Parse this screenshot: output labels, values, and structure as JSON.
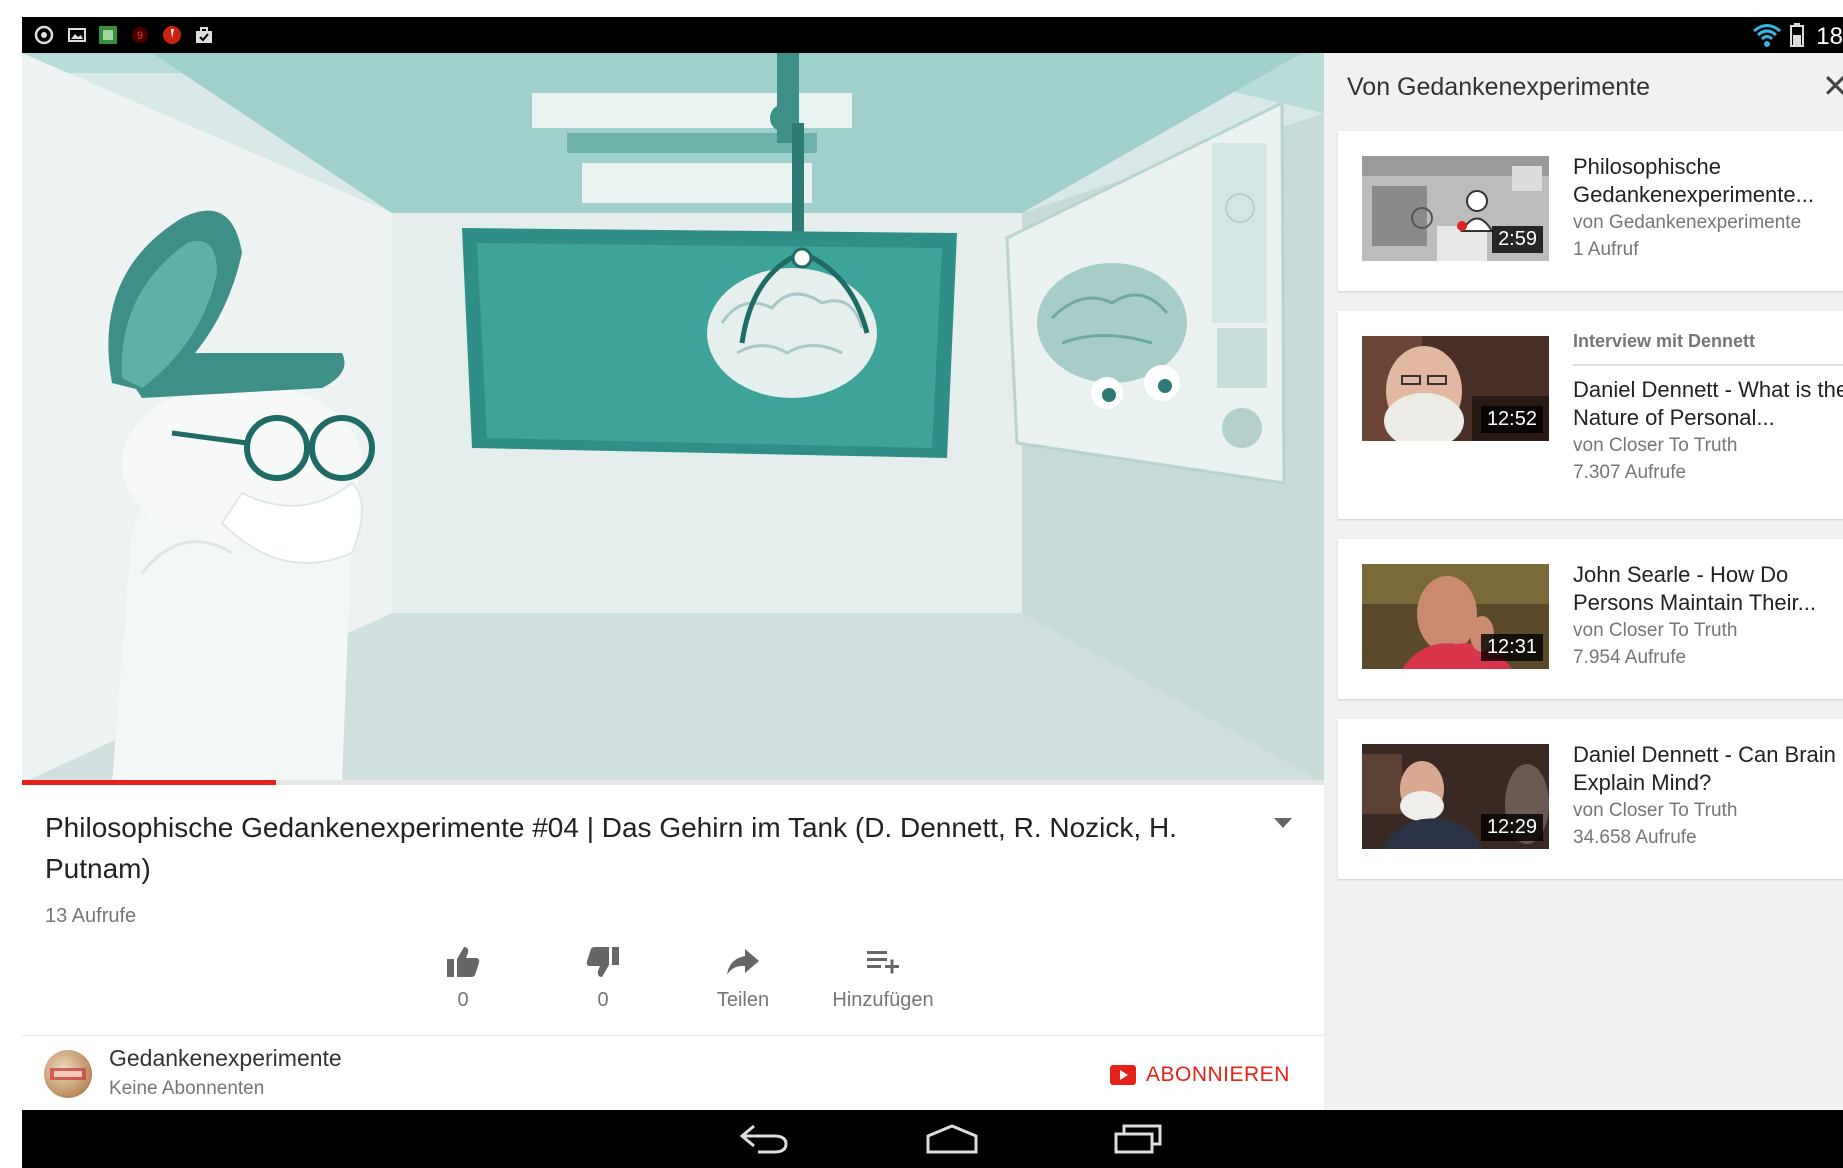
{
  "status_bar": {
    "time": "18",
    "left_icons": [
      "circle-icon",
      "image-icon",
      "app-icon",
      "notification-icon",
      "alert-icon",
      "briefcase-icon"
    ],
    "right_icons": [
      "wifi-icon",
      "battery-icon"
    ]
  },
  "player": {
    "progress": 0.195,
    "accent": "#e62117"
  },
  "video": {
    "title": "Philosophische Gedankenexperimente #04 | Das Gehirn im Tank (D. Dennett, R. Nozick, H. Putnam)",
    "views": "13 Aufrufe"
  },
  "actions": {
    "like_count": "0",
    "dislike_count": "0",
    "share_label": "Teilen",
    "add_label": "Hinzufügen"
  },
  "channel": {
    "name": "Gedankenexperimente",
    "subscribers": "Keine Abonnenten",
    "subscribe_label": "ABONNIEREN"
  },
  "sidebar": {
    "header": "Von Gedankenexperimente",
    "close": "✕",
    "items": [
      {
        "title": "Philosophische Gedankenexperimente...",
        "channel": "von Gedankenexperimente",
        "views": "1 Aufruf",
        "duration": "2:59"
      },
      {
        "playlist_label": "Interview mit Dennett",
        "title": "Daniel Dennett - What is the Nature of Personal...",
        "channel": "von Closer To Truth",
        "views": "7.307 Aufrufe",
        "duration": "12:52"
      },
      {
        "title": "John Searle - How Do Persons Maintain Their...",
        "channel": "von Closer To Truth",
        "views": "7.954 Aufrufe",
        "duration": "12:31"
      },
      {
        "title": "Daniel Dennett - Can Brain Explain Mind?",
        "channel": "von Closer To Truth",
        "views": "34.658 Aufrufe",
        "duration": "12:29"
      }
    ]
  },
  "nav_bar": {
    "buttons": [
      "back-icon",
      "home-icon",
      "recents-icon"
    ]
  }
}
